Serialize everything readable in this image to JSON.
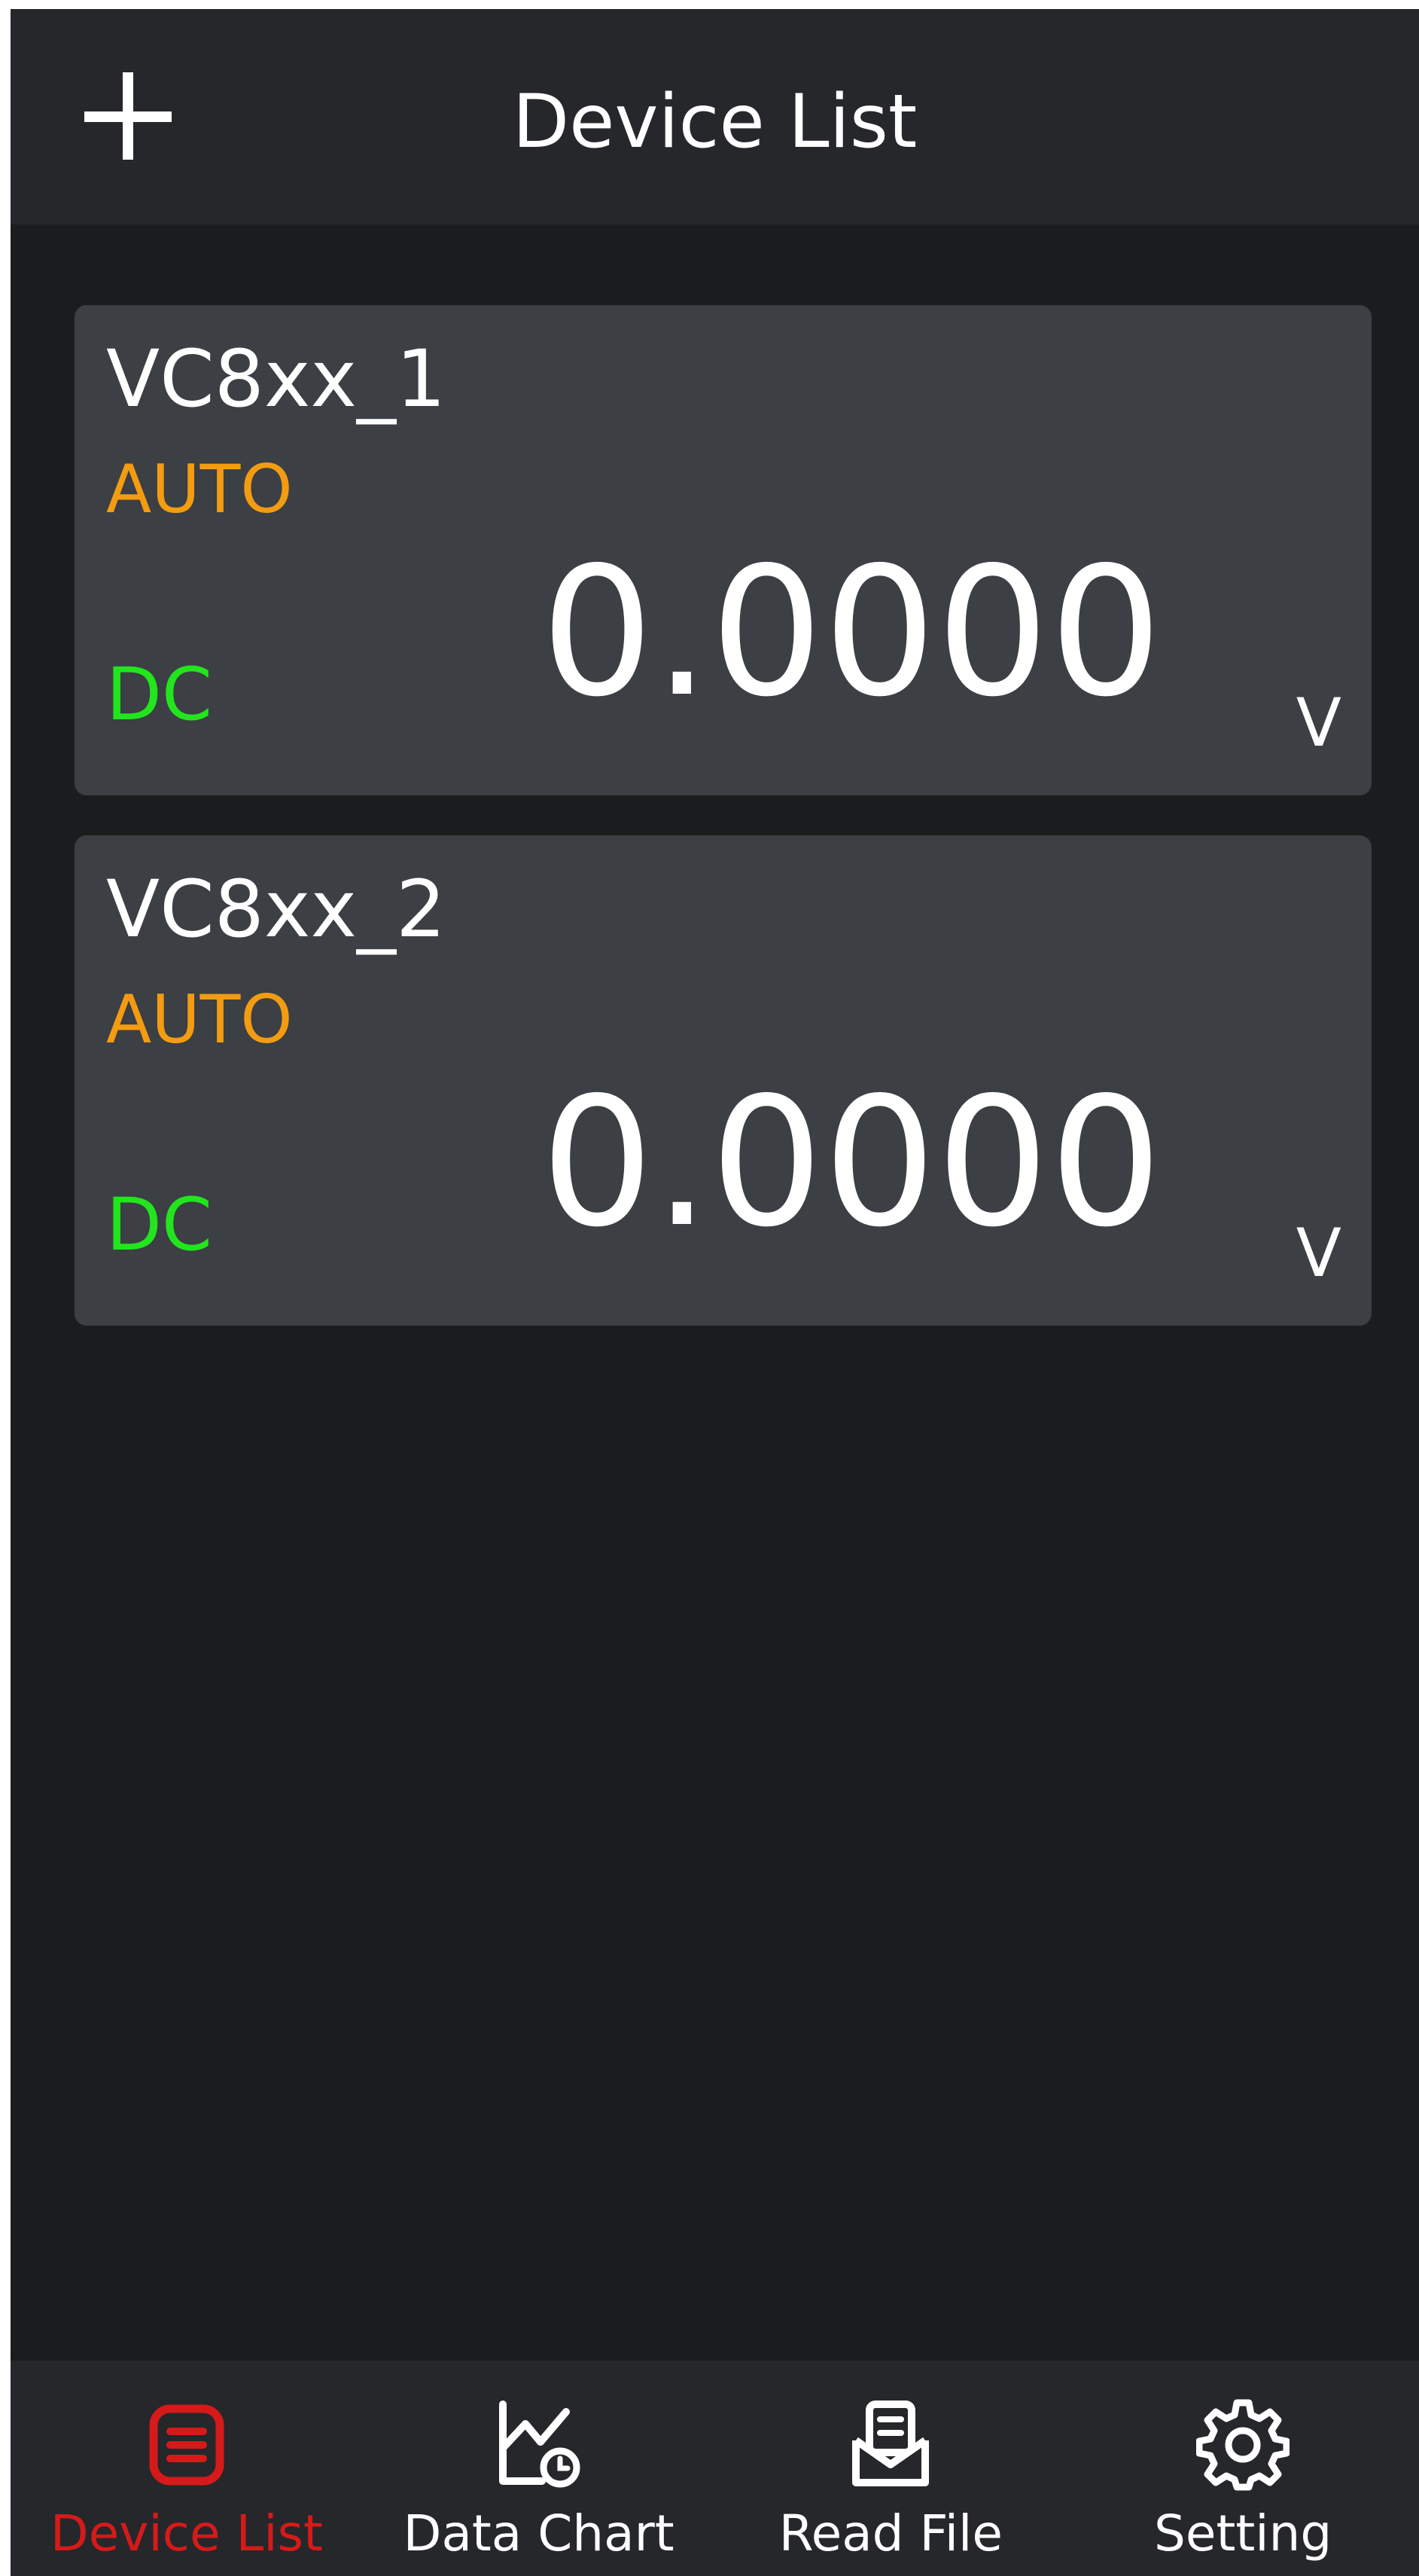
{
  "header": {
    "title": "Device List",
    "add_icon": "plus-icon"
  },
  "devices": [
    {
      "name": "VC8xx_1",
      "range_mode": "AUTO",
      "coupling": "DC",
      "reading": "0.0000",
      "unit": "V"
    },
    {
      "name": "VC8xx_2",
      "range_mode": "AUTO",
      "coupling": "DC",
      "reading": "0.0000",
      "unit": "V"
    }
  ],
  "nav": {
    "items": [
      {
        "label": "Device List",
        "icon": "device-list-icon",
        "active": true
      },
      {
        "label": "Data Chart",
        "icon": "data-chart-icon",
        "active": false
      },
      {
        "label": "Read File",
        "icon": "read-file-icon",
        "active": false
      },
      {
        "label": "Setting",
        "icon": "gear-icon",
        "active": false
      }
    ]
  },
  "colors": {
    "background": "#1b1c1e",
    "bar": "#25272a",
    "card": "#3c3f43",
    "auto": "#f39c12",
    "dc": "#22e51e",
    "active": "#d51a1a"
  }
}
